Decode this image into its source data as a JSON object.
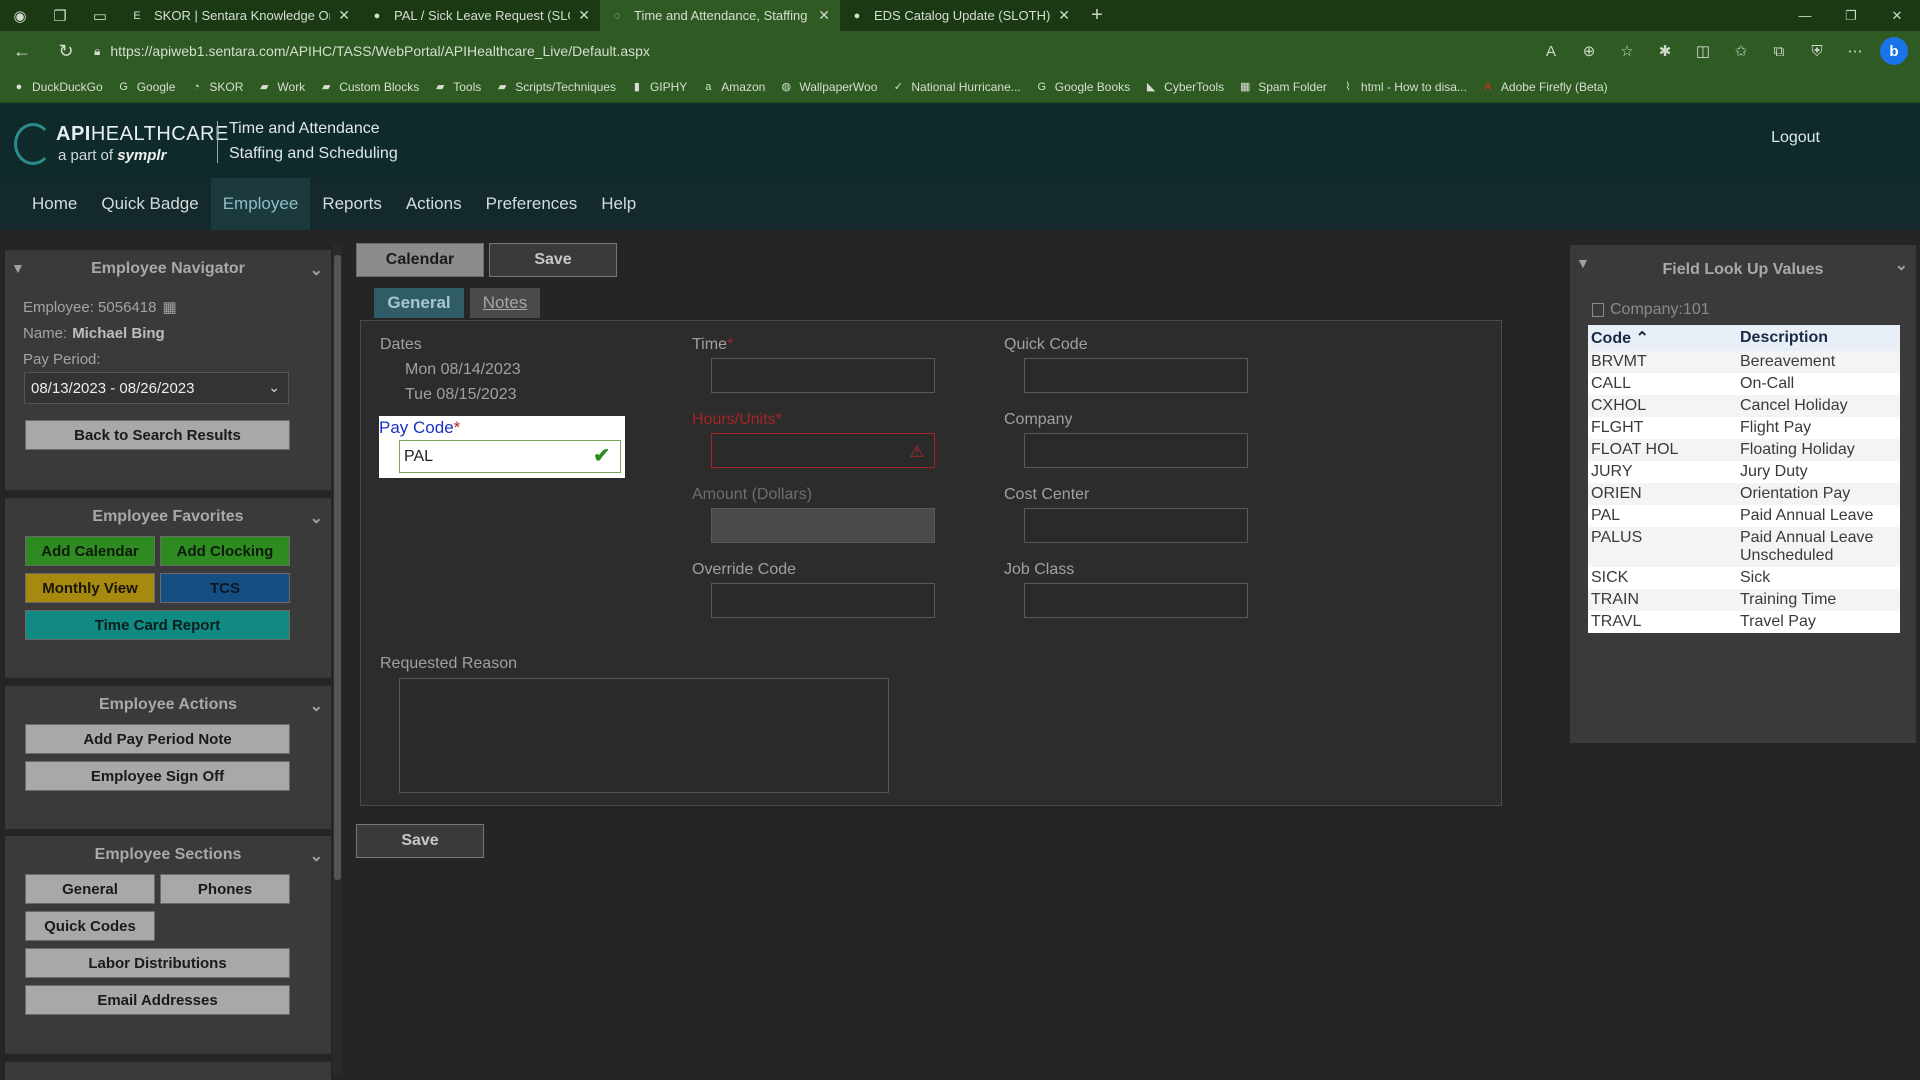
{
  "browser": {
    "tabs": [
      {
        "title": "SKOR | Sentara Knowledge Onlin",
        "active": false
      },
      {
        "title": "PAL / Sick Leave Request (SLOTH",
        "active": false
      },
      {
        "title": "Time and Attendance, Staffing ar",
        "active": true
      },
      {
        "title": "EDS Catalog Update (SLOTH) | SL",
        "active": false
      }
    ],
    "url": "https://apiweb1.sentara.com/APIHC/TASS/WebPortal/APIHealthcare_Live/Default.aspx",
    "bookmarks": [
      "DuckDuckGo",
      "Google",
      "SKOR",
      "Work",
      "Custom Blocks",
      "Tools",
      "Scripts/Techniques",
      "GIPHY",
      "Amazon",
      "WallpaperWoo",
      "National Hurricane...",
      "Google Books",
      "CyberTools",
      "Spam Folder",
      "html - How to disa...",
      "Adobe Firefly (Beta)"
    ]
  },
  "header": {
    "logo_api": "API",
    "logo_healthcare": "HEALTHCARE",
    "logo_partof": "a part of",
    "logo_symplr": "symplr",
    "title_line1": "Time and Attendance",
    "title_line2": "Staffing and Scheduling",
    "logout": "Logout"
  },
  "menu": [
    "Home",
    "Quick Badge",
    "Employee",
    "Reports",
    "Actions",
    "Preferences",
    "Help"
  ],
  "navigator": {
    "title": "Employee Navigator",
    "employee_label": "Employee:",
    "employee_id": "5056418",
    "name_label": "Name:",
    "name": "Michael Bing",
    "pay_period_label": "Pay Period:",
    "pay_period": "08/13/2023 - 08/26/2023",
    "back_button": "Back to Search Results"
  },
  "favorites": {
    "title": "Employee Favorites",
    "buttons": [
      "Add Calendar",
      "Add Clocking",
      "Monthly View",
      "TCS",
      "Time Card Report"
    ]
  },
  "actions": {
    "title": "Employee Actions",
    "buttons": [
      "Add Pay Period Note",
      "Employee Sign Off"
    ]
  },
  "sections": {
    "title": "Employee Sections",
    "buttons": [
      "General",
      "Phones",
      "Quick Codes",
      "Labor Distributions",
      "Email Addresses"
    ]
  },
  "toolbar": {
    "calendar": "Calendar",
    "save": "Save"
  },
  "tabs": {
    "general": "General",
    "notes": "Notes"
  },
  "form": {
    "dates_label": "Dates",
    "dates": [
      "Mon 08/14/2023",
      "Tue 08/15/2023"
    ],
    "pay_code_label": "Pay Code",
    "pay_code_value": "PAL",
    "time_label": "Time",
    "hours_label": "Hours/Units",
    "amount_label": "Amount (Dollars)",
    "override_label": "Override Code",
    "quick_code_label": "Quick Code",
    "company_label": "Company",
    "cost_center_label": "Cost Center",
    "job_class_label": "Job Class",
    "requested_reason_label": "Requested Reason",
    "required_mark": "*",
    "save_bottom": "Save"
  },
  "lookup": {
    "title": "Field Look Up Values",
    "company": "Company:101",
    "col_code": "Code",
    "col_desc": "Description",
    "rows": [
      {
        "code": "BRVMT",
        "desc": "Bereavement"
      },
      {
        "code": "CALL",
        "desc": "On-Call"
      },
      {
        "code": "CXHOL",
        "desc": "Cancel Holiday"
      },
      {
        "code": "FLGHT",
        "desc": "Flight Pay"
      },
      {
        "code": "FLOAT HOL",
        "desc": "Floating Holiday"
      },
      {
        "code": "JURY",
        "desc": "Jury Duty"
      },
      {
        "code": "ORIEN",
        "desc": "Orientation Pay"
      },
      {
        "code": "PAL",
        "desc": "Paid Annual Leave"
      },
      {
        "code": "PALUS",
        "desc": "Paid Annual Leave Unscheduled"
      },
      {
        "code": "SICK",
        "desc": "Sick"
      },
      {
        "code": "TRAIN",
        "desc": "Training Time"
      },
      {
        "code": "TRAVL",
        "desc": "Travel Pay"
      }
    ]
  }
}
